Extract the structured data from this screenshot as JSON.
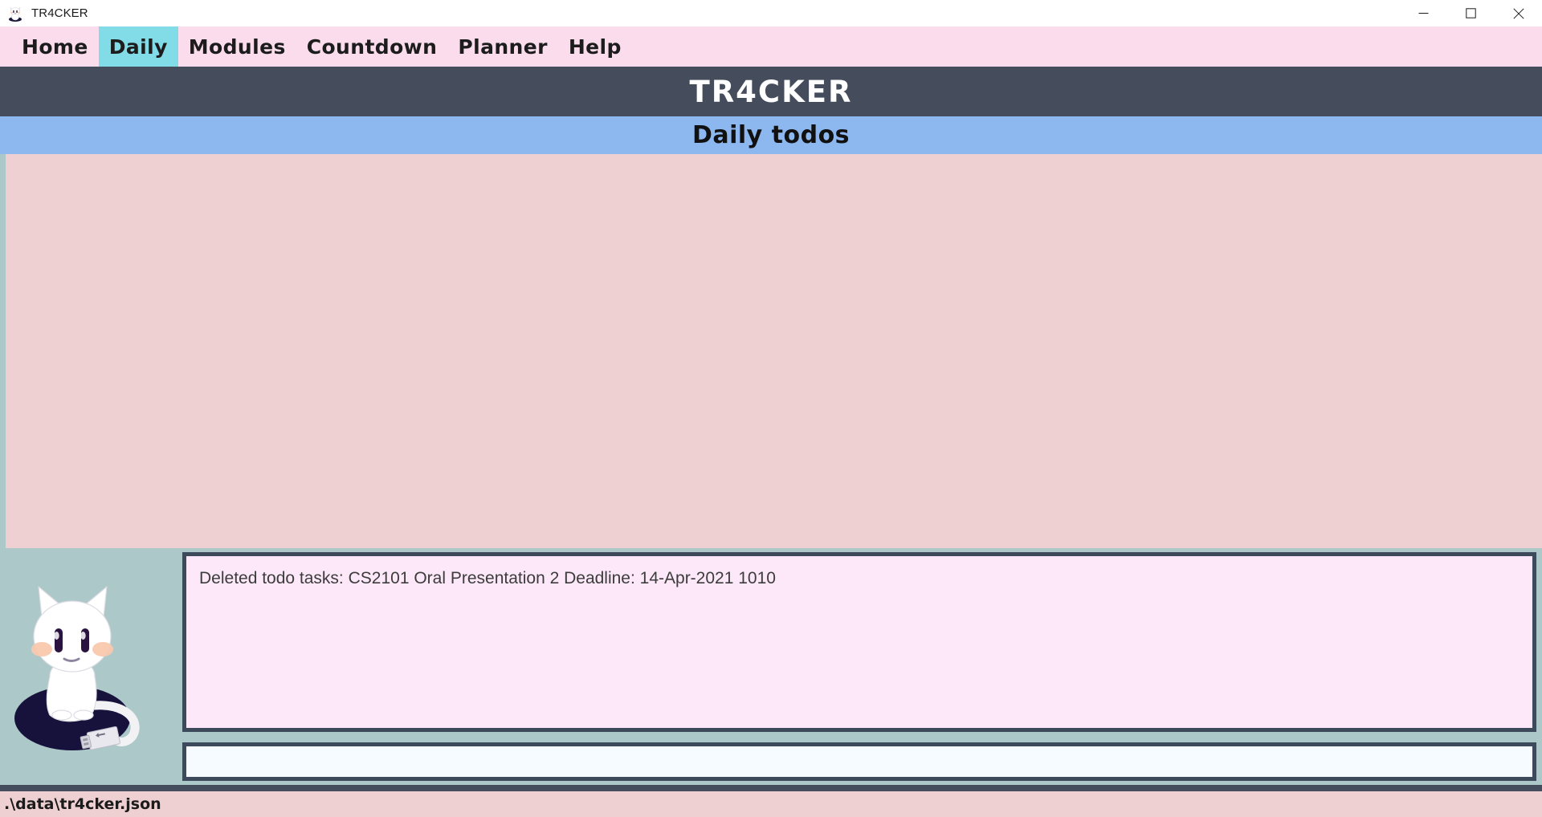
{
  "window": {
    "title": "TR4CKER",
    "app_icon": "cat-mascot-icon",
    "controls": {
      "minimize": "minimize-icon",
      "maximize": "maximize-icon",
      "close": "close-icon"
    }
  },
  "menu": {
    "items": [
      {
        "label": "Home",
        "active": false
      },
      {
        "label": "Daily",
        "active": true
      },
      {
        "label": "Modules",
        "active": false
      },
      {
        "label": "Countdown",
        "active": false
      },
      {
        "label": "Planner",
        "active": false
      },
      {
        "label": "Help",
        "active": false
      }
    ]
  },
  "banner": {
    "title": "TR4CKER"
  },
  "subtitle": {
    "text": "Daily todos"
  },
  "list_panel": {
    "items": []
  },
  "mascot": {
    "name": "cat-mascot-illustration"
  },
  "result_display": {
    "text": "Deleted todo tasks: CS2101 Oral Presentation 2 Deadline: 14-Apr-2021 1010"
  },
  "command_box": {
    "value": "",
    "placeholder": ""
  },
  "status_bar": {
    "file_path": ".\\data\\tr4cker.json"
  },
  "colors": {
    "menu_bar": "#FADCEC",
    "menu_active": "#82DCE8",
    "banner": "#454D5C",
    "subtitle_bar": "#8DB8EF",
    "list_panel": "#EFD0D2",
    "page_background": "#ACC8C8",
    "result_box": "#FCE8F8",
    "command_box": "#F5FBFE",
    "box_border": "#3D4A5C",
    "status_bar": "#EFD0D2"
  }
}
